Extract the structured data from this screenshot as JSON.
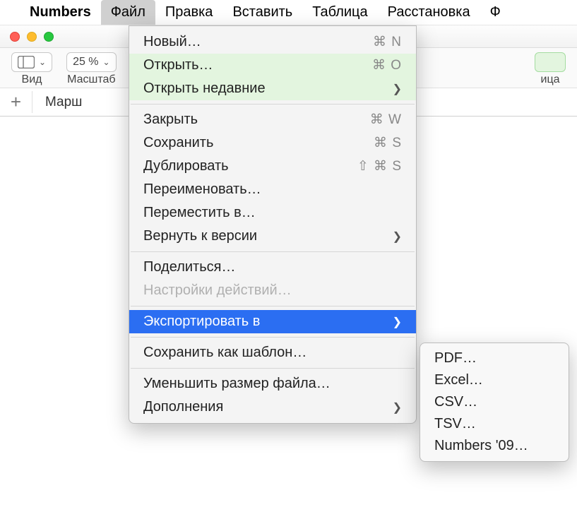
{
  "menubar": {
    "app": "Numbers",
    "items": [
      "Файл",
      "Правка",
      "Вставить",
      "Таблица",
      "Расстановка",
      "Ф"
    ]
  },
  "toolbar": {
    "view": "Вид",
    "zoom_value": "25 %",
    "zoom_label": "Масштаб",
    "table_label": "ица"
  },
  "sheet": {
    "name": "Марш"
  },
  "menu": {
    "new": "Новый…",
    "open": "Открыть…",
    "open_recent": "Открыть недавние",
    "close": "Закрыть",
    "save": "Сохранить",
    "duplicate": "Дублировать",
    "rename": "Переименовать…",
    "move_to": "Переместить в…",
    "revert": "Вернуть к версии",
    "share": "Поделиться…",
    "action_settings": "Настройки действий…",
    "export_to": "Экспортировать в",
    "save_template": "Сохранить как шаблон…",
    "reduce_size": "Уменьшить размер файла…",
    "extras": "Дополнения"
  },
  "shortcuts": {
    "new": "⌘ N",
    "open": "⌘ O",
    "close": "⌘ W",
    "save": "⌘ S",
    "duplicate": "⇧ ⌘ S"
  },
  "submenu": {
    "pdf": "PDF…",
    "excel": "Excel…",
    "csv": "CSV…",
    "tsv": "TSV…",
    "numbers09": "Numbers '09…"
  }
}
